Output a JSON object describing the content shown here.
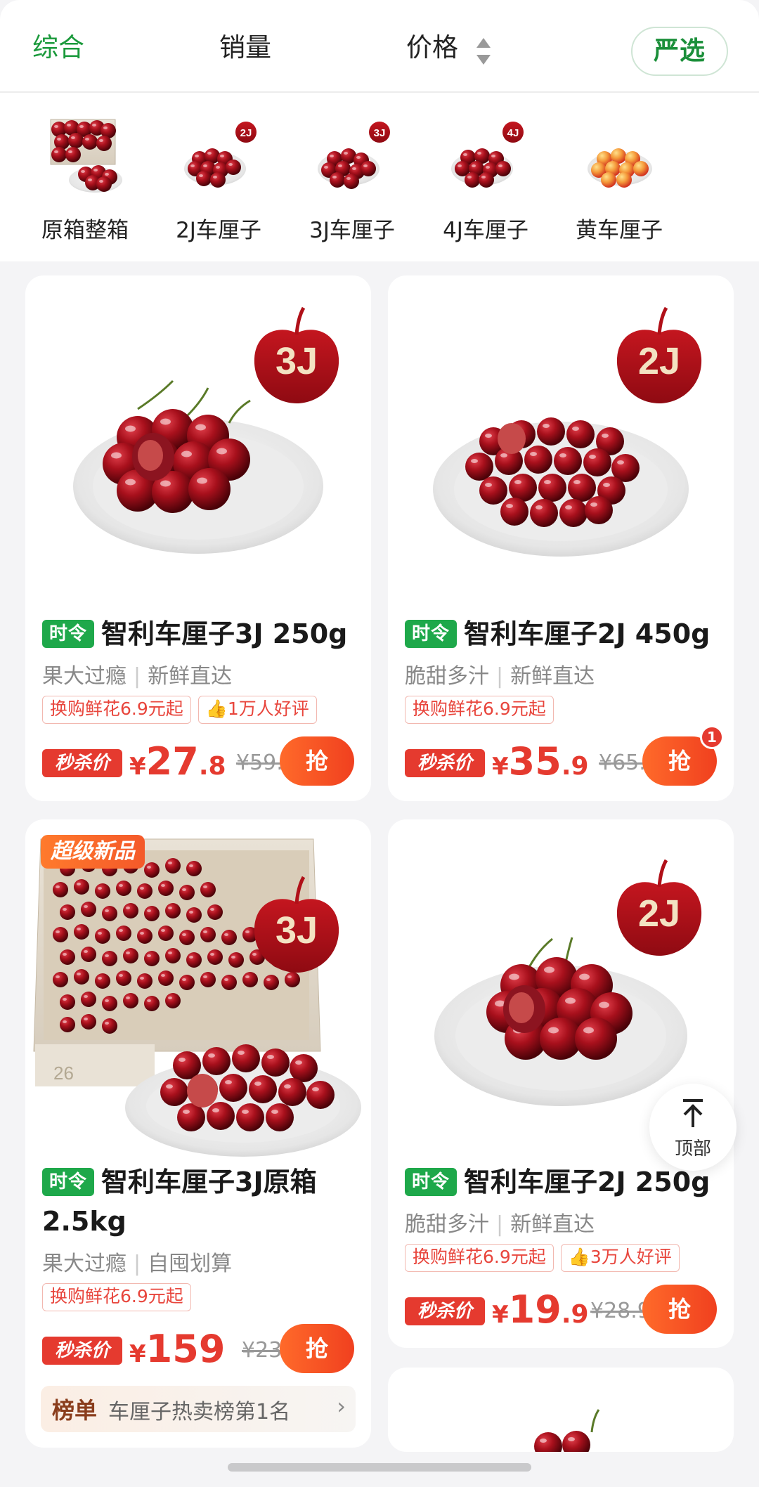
{
  "sort_bar": {
    "items": [
      "综合",
      "销量",
      "价格"
    ],
    "yanxuan": "严选"
  },
  "categories": [
    {
      "label": "原箱整箱",
      "grade": ""
    },
    {
      "label": "2J车厘子",
      "grade": "2J"
    },
    {
      "label": "3J车厘子",
      "grade": "3J"
    },
    {
      "label": "4J车厘子",
      "grade": "4J"
    },
    {
      "label": "黄车厘子",
      "grade": ""
    }
  ],
  "products": [
    {
      "grade": "3J",
      "badge": "时令",
      "title": "智利车厘子3J 250g",
      "tags": [
        "果大过瘾",
        "新鲜直达"
      ],
      "chips": [
        "换购鲜花6.9元起",
        "1万人好评"
      ],
      "seckill": "秒杀价",
      "yen": "¥",
      "price_int": "27",
      "price_dec": ".8",
      "original": "¥59.9",
      "buy": "抢"
    },
    {
      "grade": "2J",
      "badge": "时令",
      "title": "智利车厘子2J 450g",
      "tags": [
        "脆甜多汁",
        "新鲜直达"
      ],
      "chips": [
        "换购鲜花6.9元起"
      ],
      "seckill": "秒杀价",
      "yen": "¥",
      "price_int": "35",
      "price_dec": ".9",
      "original": "¥65.9",
      "buy": "抢",
      "cart_count": "1"
    },
    {
      "grade": "3J",
      "new_badge": "超级新品",
      "box_text": "26",
      "badge": "时令",
      "title": "智利车厘子3J原箱",
      "title_line2": "2.5kg",
      "tags": [
        "果大过瘾",
        "自囤划算"
      ],
      "chips": [
        "换购鲜花6.9元起"
      ],
      "seckill": "秒杀价",
      "yen": "¥",
      "price_int": "159",
      "price_dec": "",
      "original": "¥239",
      "buy": "抢",
      "rank_tag": "榜单",
      "rank_text": "车厘子热卖榜第1名"
    },
    {
      "grade": "2J",
      "badge": "时令",
      "title": "智利车厘子2J 250g",
      "tags": [
        "脆甜多汁",
        "新鲜直达"
      ],
      "chips": [
        "换购鲜花6.9元起",
        "3万人好评"
      ],
      "seckill": "秒杀价",
      "yen": "¥",
      "price_int": "19",
      "price_dec": ".9",
      "original": "¥28.9",
      "buy": "抢"
    }
  ],
  "back_to_top": "顶部",
  "colors": {
    "brand_green": "#1b9a3c",
    "price_red": "#e53a2f",
    "cherry": "#a8101c"
  }
}
